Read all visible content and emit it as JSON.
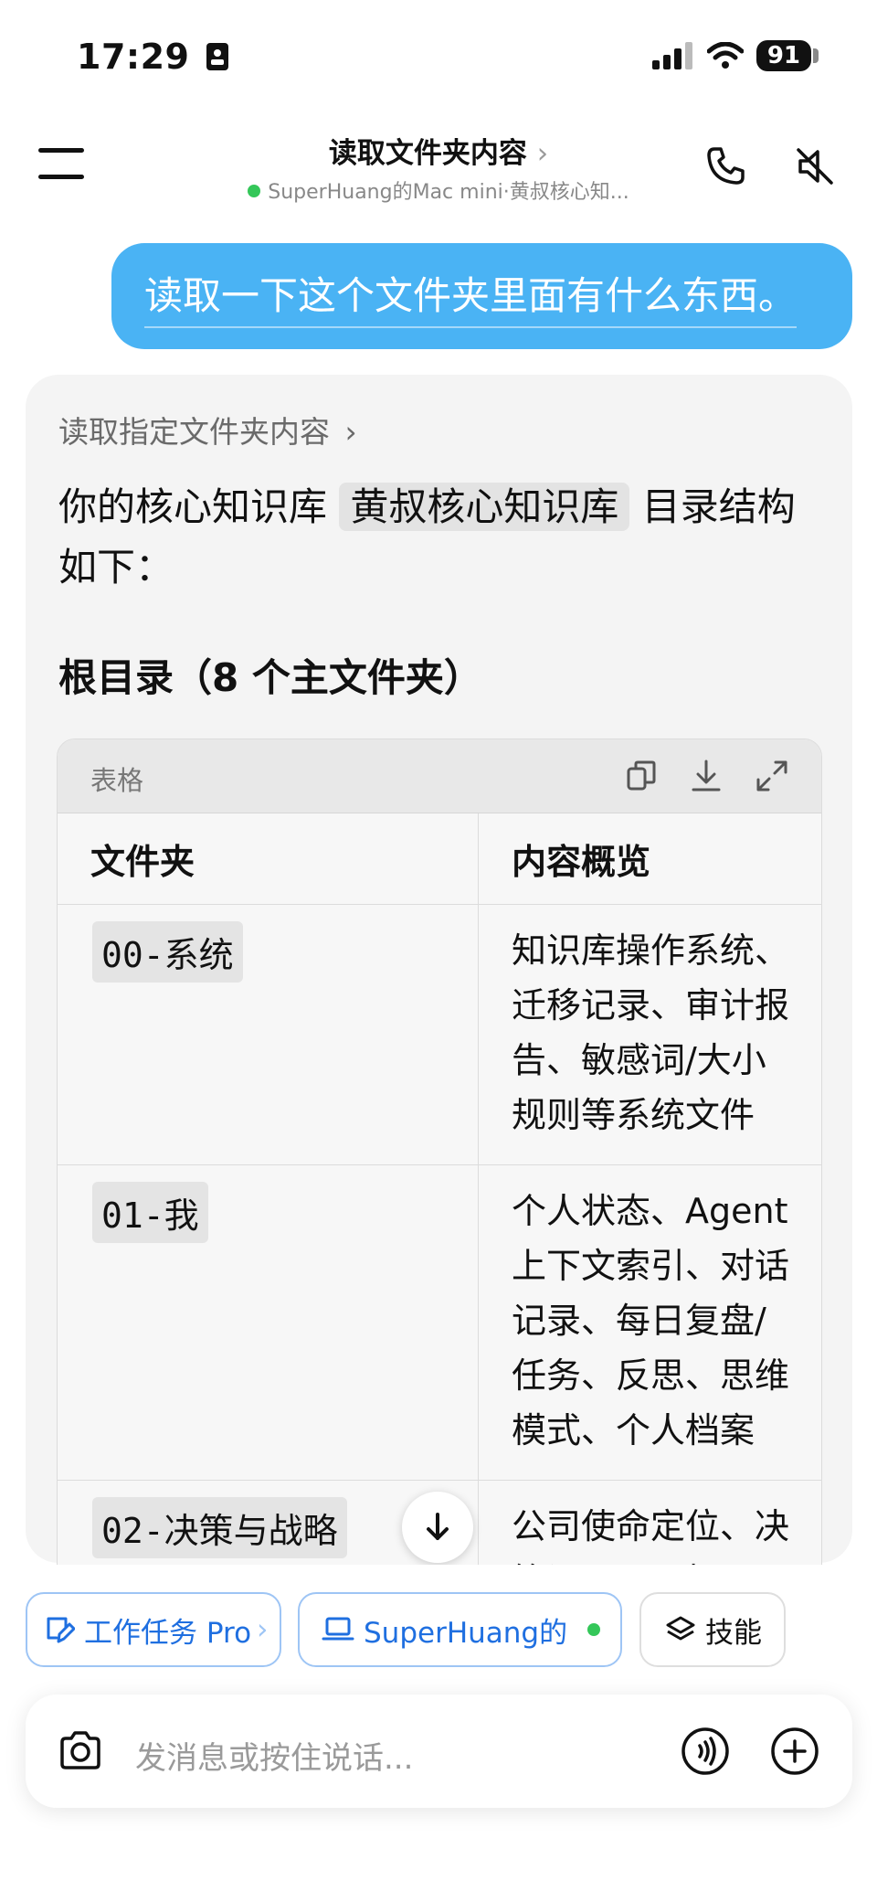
{
  "status_bar": {
    "time": "17:29",
    "battery": "91"
  },
  "header": {
    "title": "读取文件夹内容",
    "title_chevron": "›",
    "subtitle": "SuperHuang的Mac mini·黄叔核心知..."
  },
  "user_message": "读取一下这个文件夹里面有什么东西。",
  "assistant": {
    "tool_call": "读取指定文件夹内容",
    "intro_pre": "你的核心知识库 ",
    "intro_code": "黄叔核心知识库",
    "intro_post": " 目录结构如下：",
    "section_title": "根目录（8 个主文件夹）",
    "table": {
      "label": "表格",
      "headers": [
        "文件夹",
        "内容概览"
      ],
      "rows": [
        {
          "folder": "00-系统",
          "overview": "知识库操作系统、迁移记录、审计报告、敏感词/大小规则等系统文件"
        },
        {
          "folder": "01-我",
          "overview": "个人状态、Agent 上下文索引、对话记录、每日复盘/任务、反思、思维模式、个人档案"
        },
        {
          "folder": "02-决策与战略",
          "overview": "公司使命定位、决策记录、目标"
        }
      ]
    }
  },
  "chips": {
    "task": "工作任务 Pro",
    "task_chevron": "›",
    "device": "SuperHuang的",
    "skills": "技能"
  },
  "input": {
    "placeholder": "发消息或按住说话..."
  },
  "colors": {
    "accent": "#4ab3f4",
    "link_blue": "#1f6fe0",
    "online": "#34c759"
  },
  "icons": [
    "menu-icon",
    "phone-icon",
    "mute-icon",
    "copy-icon",
    "download-icon",
    "expand-icon",
    "arrow-down-icon",
    "task-icon",
    "laptop-icon",
    "layers-icon",
    "camera-icon",
    "voice-icon",
    "plus-icon",
    "signal-icon",
    "wifi-icon",
    "id-card-icon"
  ]
}
